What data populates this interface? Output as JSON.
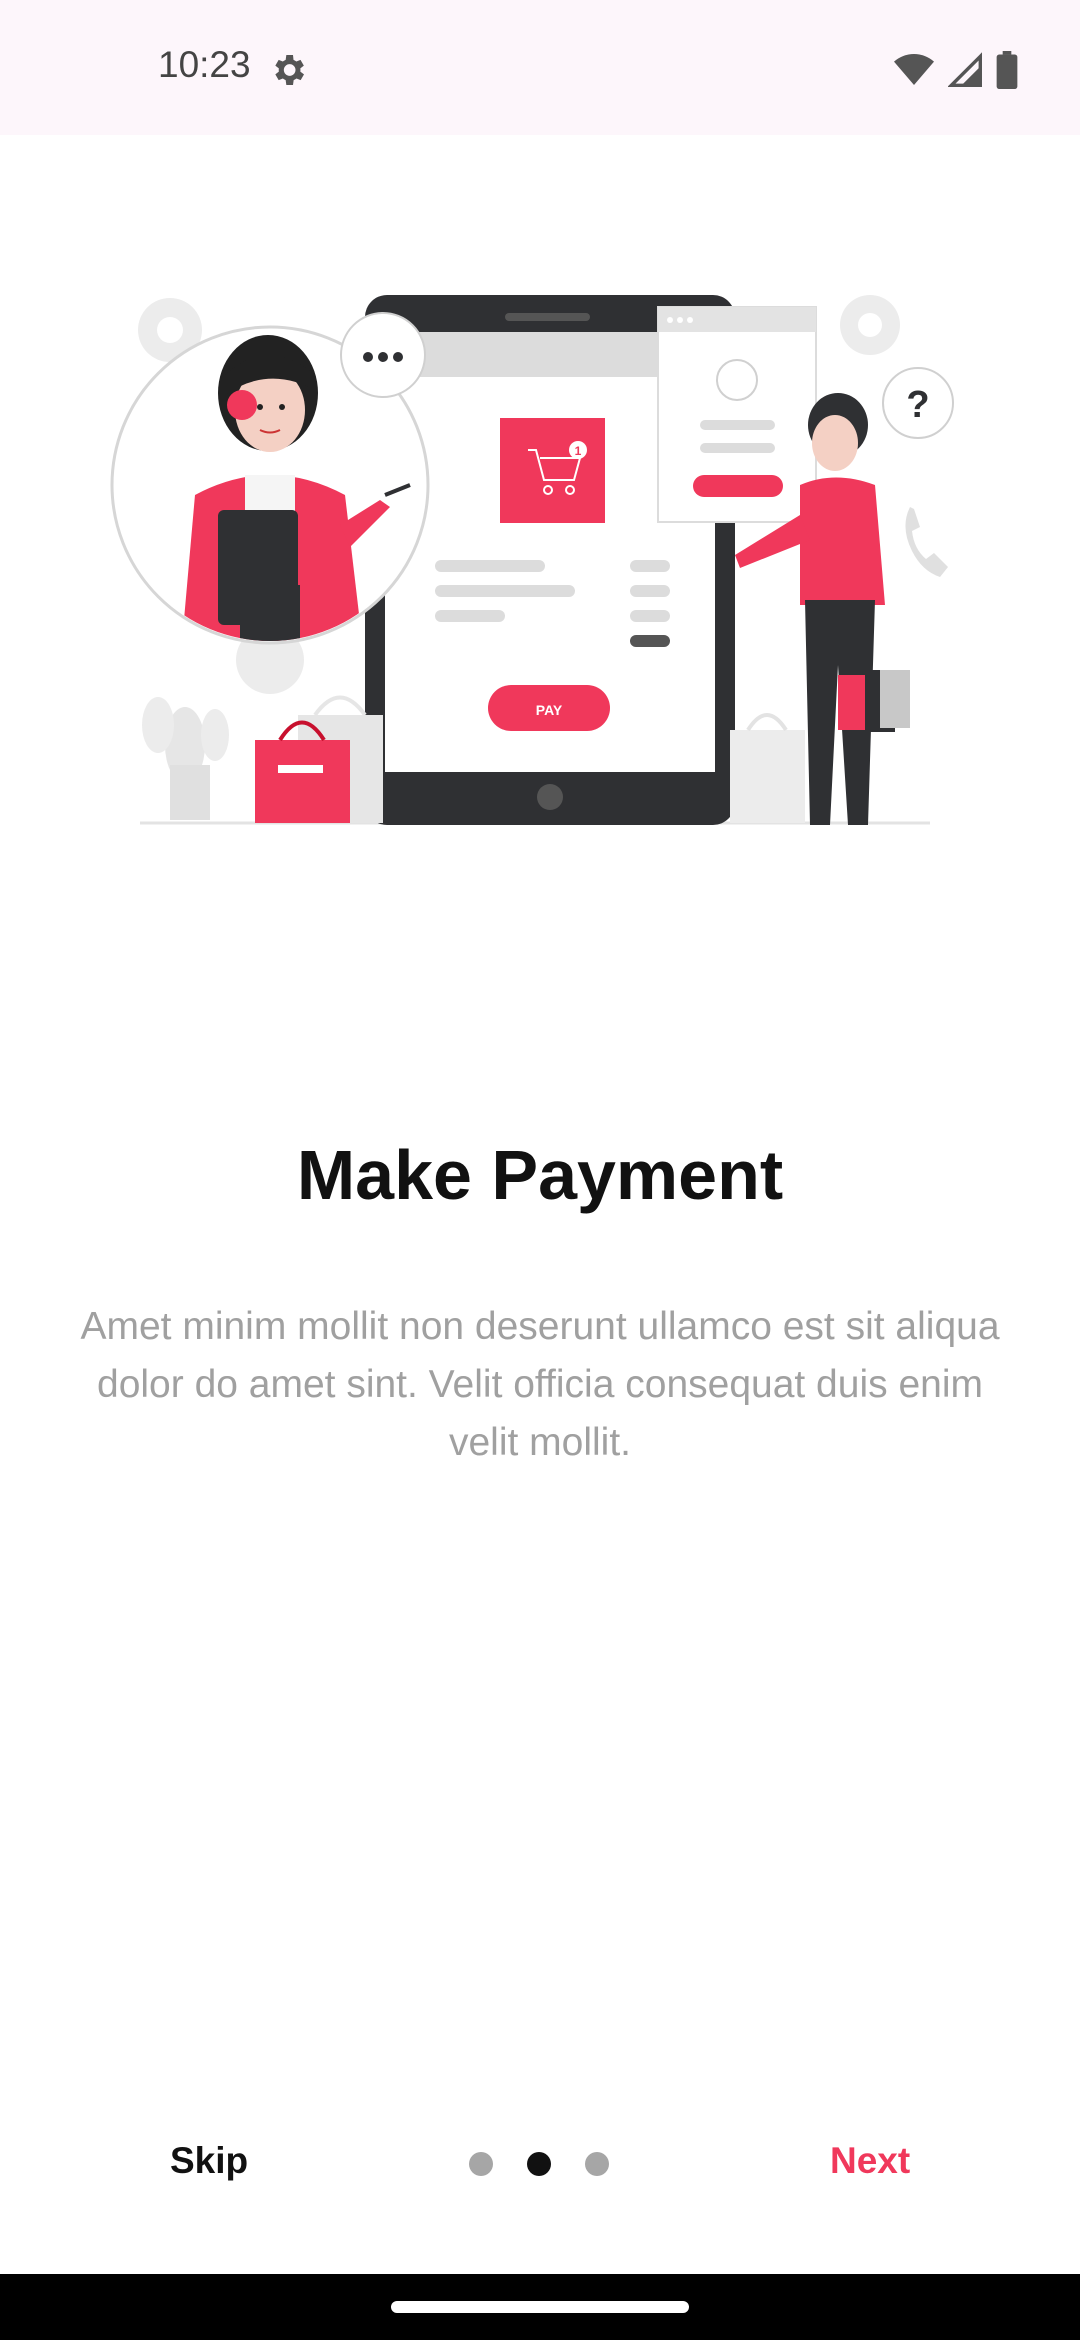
{
  "status_bar": {
    "time": "10:23",
    "icons": [
      "settings-gear-icon",
      "wifi-icon",
      "signal-icon",
      "battery-icon"
    ]
  },
  "onboarding": {
    "illustration": "make-payment-illustration",
    "title": "Make Payment",
    "description": "Amet minim mollit non deserunt ullamco est sit aliqua dolor do amet sint. Velit officia consequat duis enim velit mollit.",
    "page_index": 2,
    "page_count": 3
  },
  "controls": {
    "skip_label": "Skip",
    "next_label": "Next"
  },
  "illustration_text": {
    "pay_button": "PAY",
    "cart_badge": "1",
    "question_mark": "?"
  },
  "colors": {
    "accent": "#f0385b",
    "title": "#111111",
    "description": "#a0a0a0",
    "status_bar_bg": "#fdf6fb",
    "dot_inactive": "#a6a6a6",
    "dot_active": "#111111"
  }
}
